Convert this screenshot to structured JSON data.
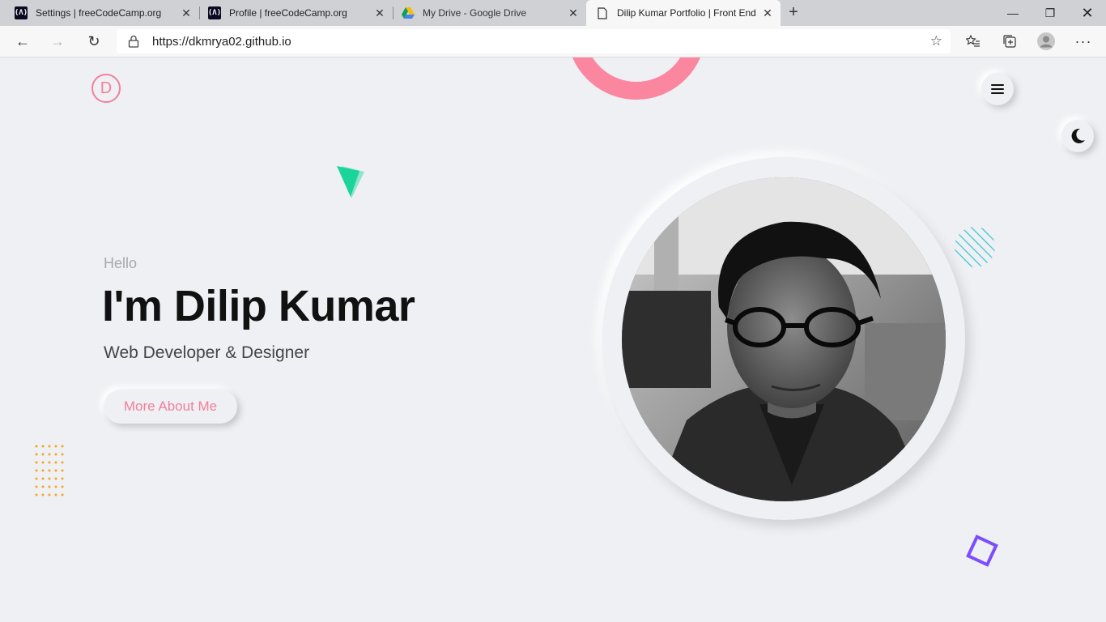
{
  "browser": {
    "tabs": [
      {
        "title": "Settings | freeCodeCamp.org",
        "icon": "freecodecamp-icon"
      },
      {
        "title": "Profile | freeCodeCamp.org",
        "icon": "freecodecamp-icon"
      },
      {
        "title": "My Drive - Google Drive",
        "icon": "google-drive-icon"
      },
      {
        "title": "Dilip Kumar Portfolio | Front End",
        "icon": "page-icon",
        "active": true
      }
    ],
    "fcc_glyph": "(Λ)",
    "url": "https://dkmrya02.github.io"
  },
  "page": {
    "logo_letter": "D",
    "hello": "Hello",
    "name": "I'm Dilip Kumar",
    "role": "Web Developer & Designer",
    "cta": "More About Me"
  },
  "colors": {
    "accent_pink": "#f37f9c",
    "ring_pink": "#fb86a0",
    "triangle_green": "#1bd49a",
    "dots_orange": "#f5a623",
    "stripes_cyan": "#3ec7d6",
    "square_purple": "#7c4dff",
    "background": "#eef0f3"
  }
}
